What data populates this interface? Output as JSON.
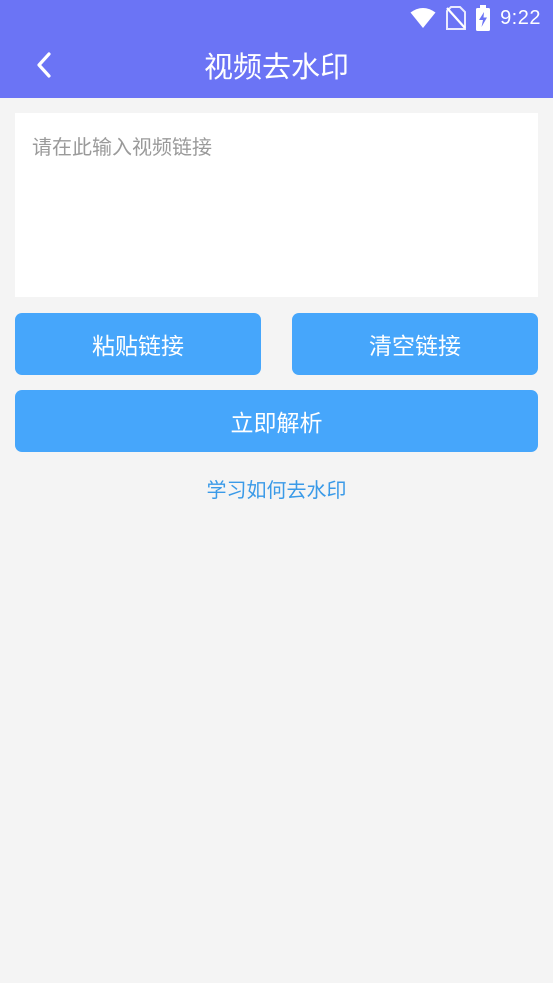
{
  "status_bar": {
    "time": "9:22",
    "icons": [
      "wifi-icon",
      "no-sim-icon",
      "battery-charging-icon"
    ]
  },
  "toolbar": {
    "back_icon": "chevron-left-icon",
    "title": "视频去水印"
  },
  "input": {
    "value": "",
    "placeholder": "请在此输入视频链接"
  },
  "buttons": {
    "paste_label": "粘贴链接",
    "clear_label": "清空链接",
    "parse_label": "立即解析"
  },
  "help_link": {
    "label": "学习如何去水印"
  },
  "colors": {
    "header": "#6b74f5",
    "button": "#46a6fb",
    "link": "#3a9ae8",
    "background": "#f4f4f4"
  }
}
